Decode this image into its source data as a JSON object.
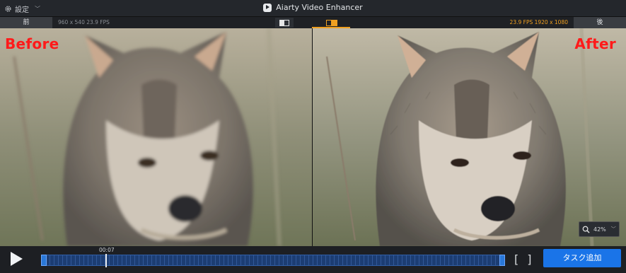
{
  "titlebar": {
    "settings_label": "設定",
    "settings_icon": "gear-icon",
    "app_title": "Aiarty Video Enhancer"
  },
  "infobar": {
    "before_tab": "前",
    "after_tab": "後",
    "before_info": "960 x 540  23.9 FPS",
    "after_info": "23.9 FPS  1920 x 1080",
    "accent": "#f0a020"
  },
  "preview": {
    "before_label": "Before",
    "after_label": "After",
    "label_color": "#ff1a1a"
  },
  "zoom": {
    "value": "42%",
    "icon": "zoom-icon"
  },
  "playback": {
    "timecode": "00:07",
    "play_icon": "play-icon",
    "bracket_in": "[",
    "bracket_out": "]",
    "add_task_label": "タスク追加",
    "button_color": "#1a74e8"
  }
}
